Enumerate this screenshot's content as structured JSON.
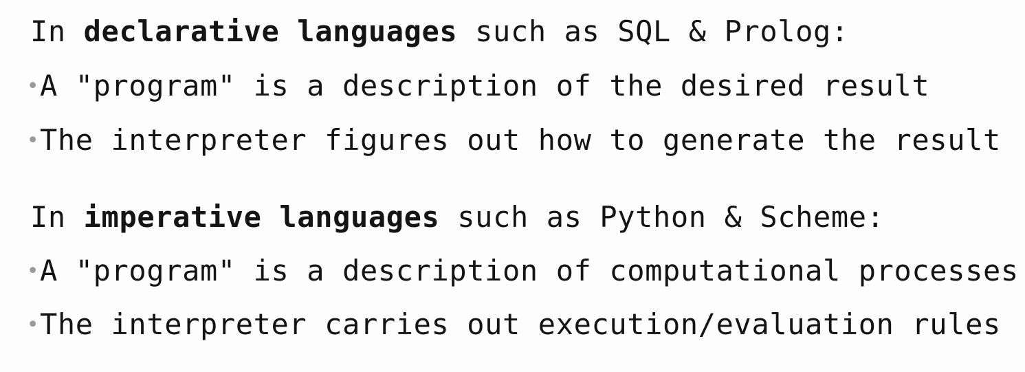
{
  "sections": [
    {
      "heading": {
        "prefix": "In ",
        "bold": "declarative languages",
        "suffix": " such as SQL & Prolog:"
      },
      "bullets": [
        "A \"program\" is a description of the desired result",
        "The interpreter figures out how to generate the result"
      ]
    },
    {
      "heading": {
        "prefix": "In ",
        "bold": "imperative languages",
        "suffix": " such as Python & Scheme:"
      },
      "bullets": [
        "A \"program\" is a description of computational processes",
        "The interpreter carries out execution/evaluation rules"
      ]
    }
  ],
  "bullet_glyph": "•"
}
